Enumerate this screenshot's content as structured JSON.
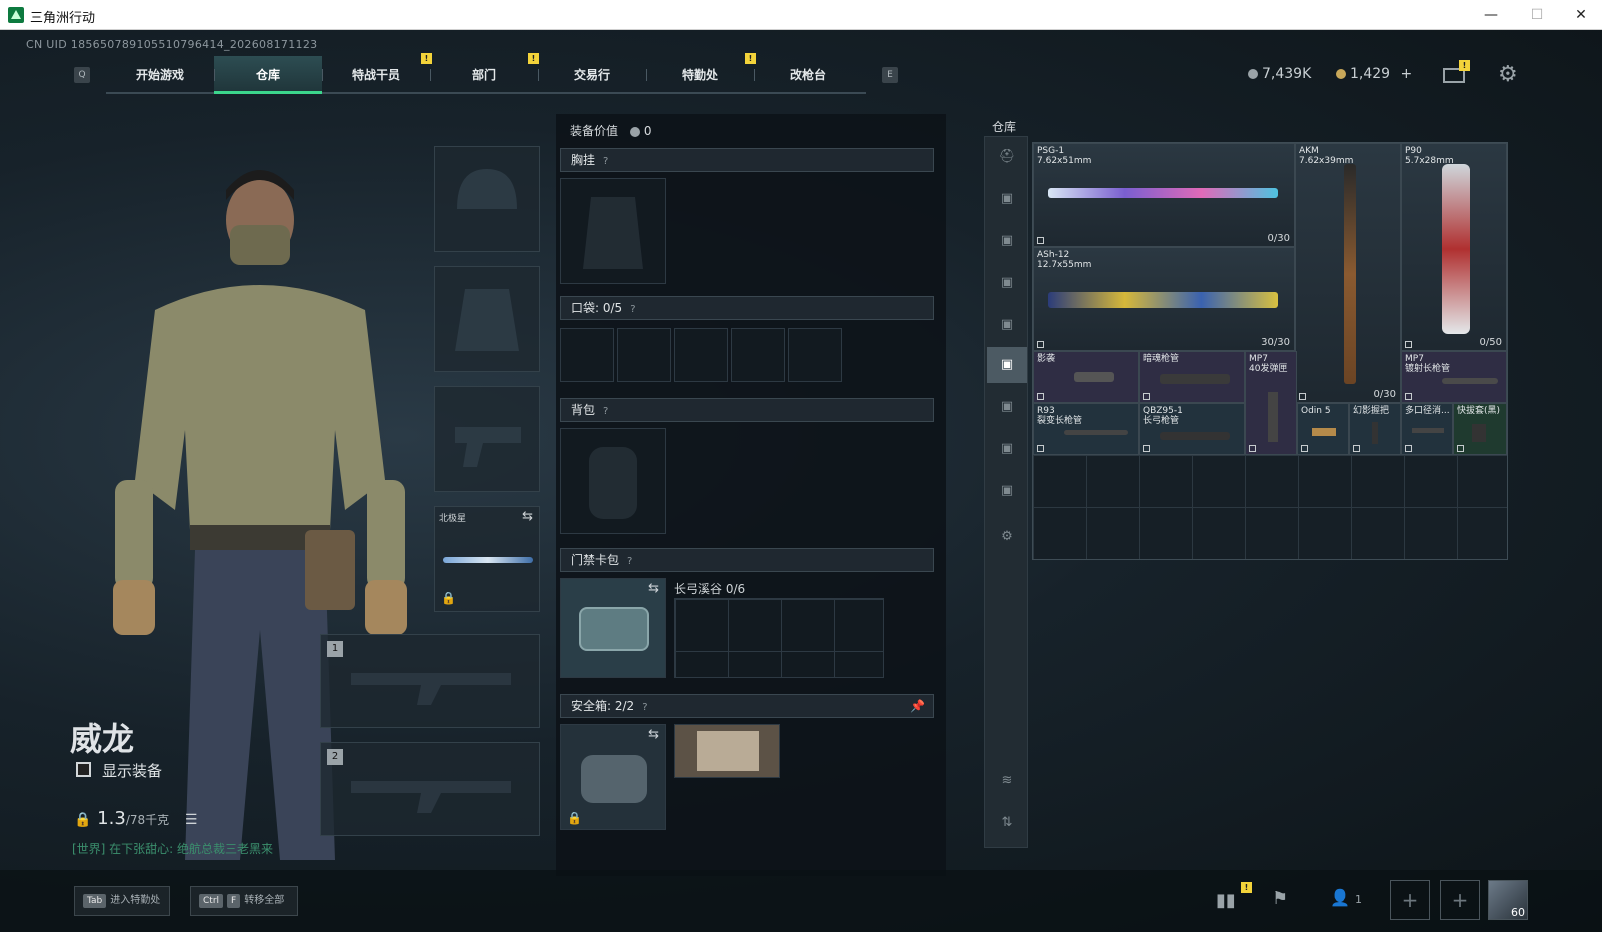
{
  "window": {
    "title": "三角洲行动",
    "minimize": "—",
    "maximize": "☐",
    "close": "✕"
  },
  "uid": "CN UID 185650789105510796414_202608171123",
  "nav": {
    "left_key": "Q",
    "right_key": "E",
    "tabs": [
      "开始游戏",
      "仓库",
      "特战干员",
      "部门",
      "交易行",
      "特勤处",
      "改枪台"
    ],
    "active": "仓库",
    "alerts": [
      "!",
      "!",
      "!"
    ]
  },
  "currency": {
    "silver": "7,439K",
    "gold": "1,429",
    "add": "+",
    "mail_alert": "!"
  },
  "character": {
    "name": "威龙",
    "show_gear_label": "显示装备",
    "weight_value": "1.3",
    "weight_max": "/78千克",
    "chat_line": "[世界] 在下张甜心: 绝航总裁三老黑来"
  },
  "loadout": {
    "melee_label": "北极星",
    "primary_1": "1",
    "primary_2": "2"
  },
  "equipment": {
    "value_label": "装备价值",
    "value": "0",
    "chest_label": "胸挂",
    "pocket_label": "口袋:",
    "pocket_value": "0/5",
    "backpack_label": "背包",
    "keycard_label": "门禁卡包",
    "keycard_name": "长弓溪谷 0/6",
    "safebox_label": "安全箱:",
    "safebox_value": "2/2",
    "help": "?"
  },
  "warehouse": {
    "title": "仓库",
    "items": [
      {
        "name": "PSG-1\n7.62x51mm",
        "count": "0/30"
      },
      {
        "name": "AKM\n7.62x39mm",
        "count": "0/30"
      },
      {
        "name": "P90\n5.7x28mm",
        "count": "0/50"
      },
      {
        "name": "ASh-12\n12.7x55mm",
        "count": "30/30"
      },
      {
        "name": "影袭",
        "count": ""
      },
      {
        "name": "暗魂枪管",
        "count": ""
      },
      {
        "name": "MP7\n40发弹匣",
        "count": ""
      },
      {
        "name": "MP7\n镀射长枪管",
        "count": ""
      },
      {
        "name": "R93\n裂变长枪管",
        "count": ""
      },
      {
        "name": "QBZ95-1\n长弓枪管",
        "count": ""
      },
      {
        "name": "Odin 5",
        "count": ""
      },
      {
        "name": "幻影握把",
        "count": ""
      },
      {
        "name": "多口径消...",
        "count": ""
      },
      {
        "name": "快拔套(黑)",
        "count": ""
      }
    ]
  },
  "bottom": {
    "tab_key": "Tab",
    "tab_label": "进入特勤处",
    "ctrl_key": "Ctrl",
    "f_key": "F",
    "transfer_label": "转移全部",
    "squad_count": "1",
    "level": "60",
    "alert": "!"
  },
  "colors": {
    "accent": "#3cd68c",
    "alert": "#f3d33a",
    "chat": "#3b8f6d"
  }
}
